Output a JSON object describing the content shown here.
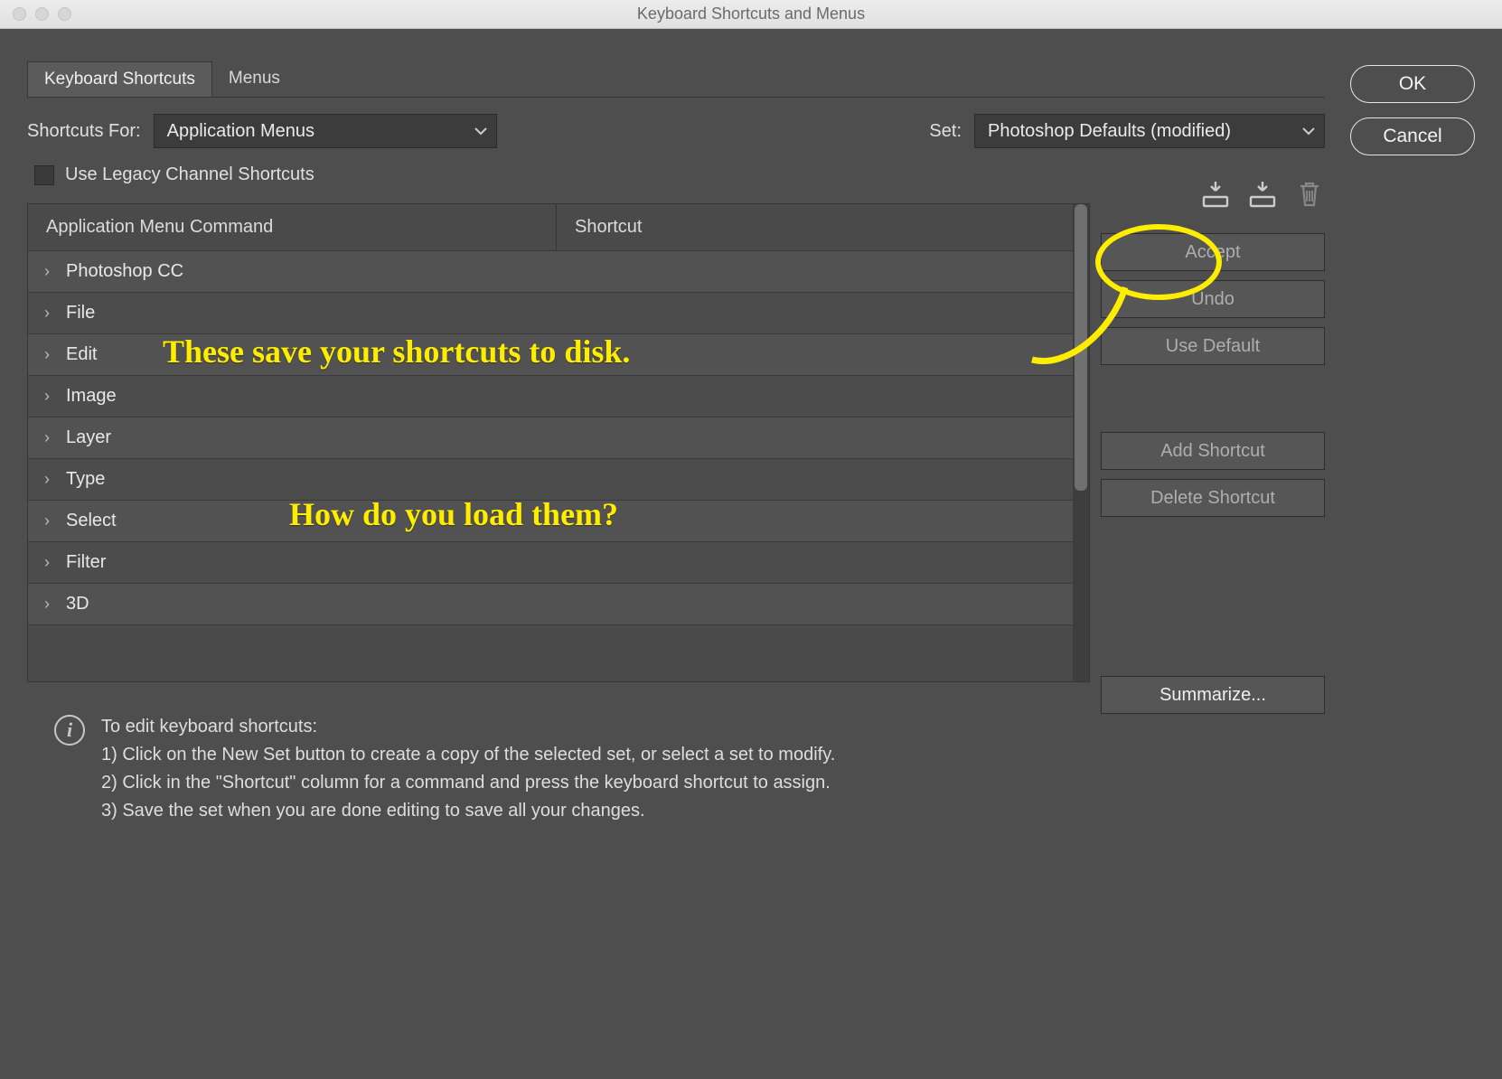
{
  "window": {
    "title": "Keyboard Shortcuts and Menus"
  },
  "tabs": {
    "shortcuts": "Keyboard Shortcuts",
    "menus": "Menus"
  },
  "labels": {
    "shortcuts_for": "Shortcuts For:",
    "set": "Set:",
    "legacy": "Use Legacy Channel Shortcuts"
  },
  "dropdowns": {
    "shortcuts_for": "Application Menus",
    "set": "Photoshop Defaults (modified)"
  },
  "icons": {
    "save1": "save-set-icon",
    "save2": "save-set-copy-icon",
    "trash": "delete-set-icon"
  },
  "table": {
    "col1": "Application Menu Command",
    "col2": "Shortcut",
    "rows": [
      "Photoshop CC",
      "File",
      "Edit",
      "Image",
      "Layer",
      "Type",
      "Select",
      "Filter",
      "3D"
    ]
  },
  "buttons": {
    "accept": "Accept",
    "undo": "Undo",
    "use_default": "Use Default",
    "add_shortcut": "Add Shortcut",
    "delete_shortcut": "Delete Shortcut",
    "summarize": "Summarize...",
    "ok": "OK",
    "cancel": "Cancel"
  },
  "instructions": {
    "head": "To edit keyboard shortcuts:",
    "l1": "1) Click on the New Set button to create a copy of the selected set, or select a set to modify.",
    "l2": "2) Click in the \"Shortcut\" column for a command and press the keyboard shortcut to assign.",
    "l3": "3) Save the set when you are done editing to save all your changes."
  },
  "annotations": {
    "a1": "These save your shortcuts to disk.",
    "a2": "How do you load them?"
  }
}
